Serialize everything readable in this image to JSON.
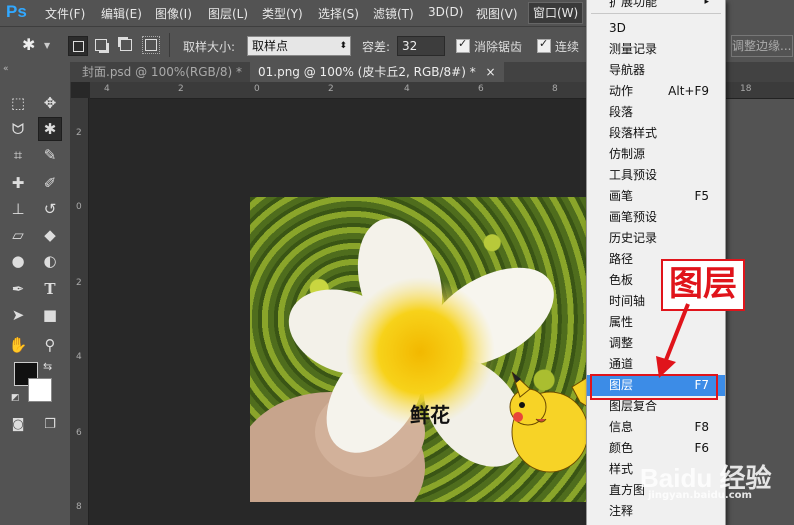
{
  "app": {
    "logo": "Ps"
  },
  "menubar": {
    "items": [
      "文件(F)",
      "编辑(E)",
      "图像(I)",
      "图层(L)",
      "类型(Y)",
      "选择(S)",
      "滤镜(T)",
      "3D(D)",
      "视图(V)",
      "窗口(W)"
    ]
  },
  "options": {
    "sample_size_label": "取样大小:",
    "sample_size_value": "取样点",
    "tolerance_label": "容差:",
    "tolerance_value": "32",
    "antialias_label": "消除锯齿",
    "contiguous_label": "连续",
    "refine_edge_label": "调整边缘..."
  },
  "tabs": [
    {
      "label": "封面.psd @ 100%(RGB/8) *",
      "close": "×"
    },
    {
      "label": "01.png @ 100% (皮卡丘2, RGB/8#) *",
      "close": "×"
    }
  ],
  "ruler": {
    "h": [
      "4",
      "2",
      "0",
      "2",
      "4",
      "6",
      "8",
      "10",
      "12",
      "14",
      "16",
      "18",
      "20"
    ],
    "v": [
      "2",
      "0",
      "2",
      "4",
      "6",
      "8",
      "1"
    ]
  },
  "canvas": {
    "caption": "鲜花"
  },
  "window_menu": {
    "top_item": "扩展功能",
    "items": [
      {
        "label": "3D",
        "shortcut": ""
      },
      {
        "label": "测量记录",
        "shortcut": ""
      },
      {
        "label": "导航器",
        "shortcut": ""
      },
      {
        "label": "动作",
        "shortcut": "Alt+F9"
      },
      {
        "label": "段落",
        "shortcut": ""
      },
      {
        "label": "段落样式",
        "shortcut": ""
      },
      {
        "label": "仿制源",
        "shortcut": ""
      },
      {
        "label": "工具预设",
        "shortcut": ""
      },
      {
        "label": "画笔",
        "shortcut": "F5"
      },
      {
        "label": "画笔预设",
        "shortcut": ""
      },
      {
        "label": "历史记录",
        "shortcut": ""
      },
      {
        "label": "路径",
        "shortcut": ""
      },
      {
        "label": "色板",
        "shortcut": ""
      },
      {
        "label": "时间轴",
        "shortcut": ""
      },
      {
        "label": "属性",
        "shortcut": ""
      },
      {
        "label": "调整",
        "shortcut": ""
      },
      {
        "label": "通道",
        "shortcut": ""
      },
      {
        "label": "图层",
        "shortcut": "F7"
      },
      {
        "label": "图层复合",
        "shortcut": ""
      },
      {
        "label": "信息",
        "shortcut": "F8"
      },
      {
        "label": "颜色",
        "shortcut": "F6"
      },
      {
        "label": "样式",
        "shortcut": ""
      },
      {
        "label": "直方图",
        "shortcut": ""
      },
      {
        "label": "注释",
        "shortcut": ""
      }
    ]
  },
  "annotation": {
    "text": "图层"
  },
  "watermark": {
    "text": "Baidu 经验",
    "sub": "jingyan.baidu.com"
  },
  "colors": {
    "highlight": "#3c8ce7",
    "annotation_red": "#e0141b",
    "ps_blue": "#31a8ff"
  }
}
